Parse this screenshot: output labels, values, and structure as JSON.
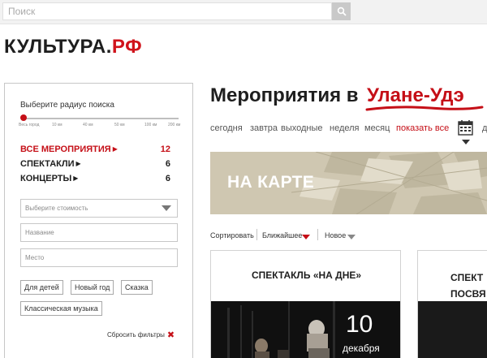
{
  "search": {
    "placeholder": "Поиск"
  },
  "logo": {
    "name": "КУЛЬТУРА",
    "dot": ".",
    "tld": "РФ"
  },
  "filters": {
    "radius_title": "Выберите радиус поиска",
    "radius_ticks": [
      "Весь город",
      "10 км",
      "40 км",
      "50 км",
      "100 км",
      "200 км"
    ],
    "radius_selected_fraction": 0,
    "categories": [
      {
        "label": "ВСЕ МЕРОПРИЯТИЯ",
        "count": "12",
        "active": true
      },
      {
        "label": "СПЕКТАКЛИ",
        "count": "6",
        "active": false
      },
      {
        "label": "КОНЦЕРТЫ",
        "count": "6",
        "active": false
      }
    ],
    "price_select": "Выберите стоимость",
    "name_placeholder": "Название",
    "place_placeholder": "Место",
    "tags": [
      "Для детей",
      "Новый год",
      "Сказка",
      "Классическая музыка"
    ],
    "reset_label": "Сбросить фильтры"
  },
  "main": {
    "title": "Мероприятия в",
    "city": "Улане-Удэ",
    "periods": [
      "сегодня",
      "завтра",
      "выходные",
      "неделя",
      "месяц",
      "показать все"
    ],
    "period_cut": "д",
    "map_label": "НА КАРТЕ",
    "sort": {
      "label": "Сортировать",
      "options": [
        "Ближайшее",
        "Новое"
      ]
    },
    "events": [
      {
        "title": "СПЕКТАКЛЬ «НА ДНЕ»",
        "day": "10",
        "month": "декабря"
      },
      {
        "title_line1": "СПЕКТ",
        "title_line2": "ПОСВЯ"
      }
    ]
  },
  "colors": {
    "accent": "#c50f17",
    "logo_red": "#d0131b",
    "text": "#1e1e1e",
    "map_bg": "#cfc7b1"
  }
}
